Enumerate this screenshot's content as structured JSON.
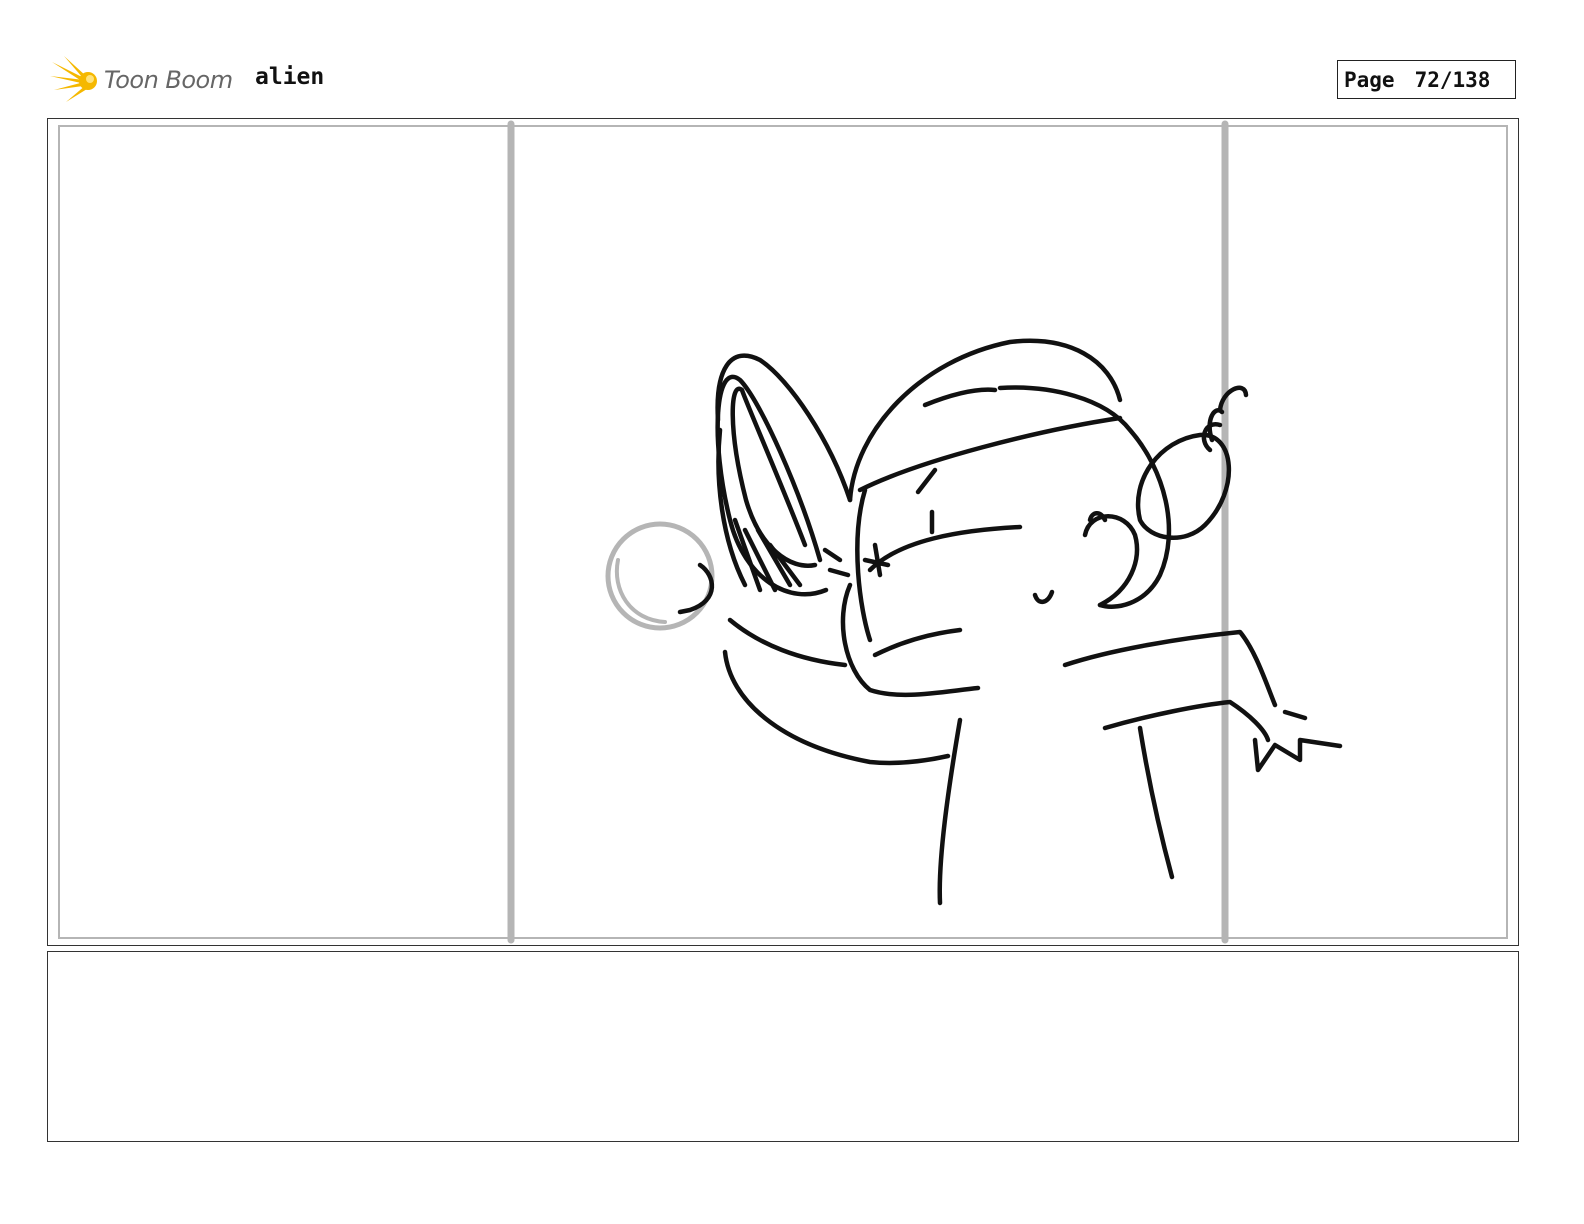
{
  "header": {
    "logo": {
      "icon": "toon-boom-comet-icon",
      "text": "Toon Boom",
      "accent_color": "#F5B800"
    },
    "project_title": "alien",
    "page": {
      "label": "Page",
      "number": "72/138"
    }
  },
  "panel": {
    "sketch_color": "#111111",
    "guide_color": "#b5b5b5",
    "notes": ""
  }
}
